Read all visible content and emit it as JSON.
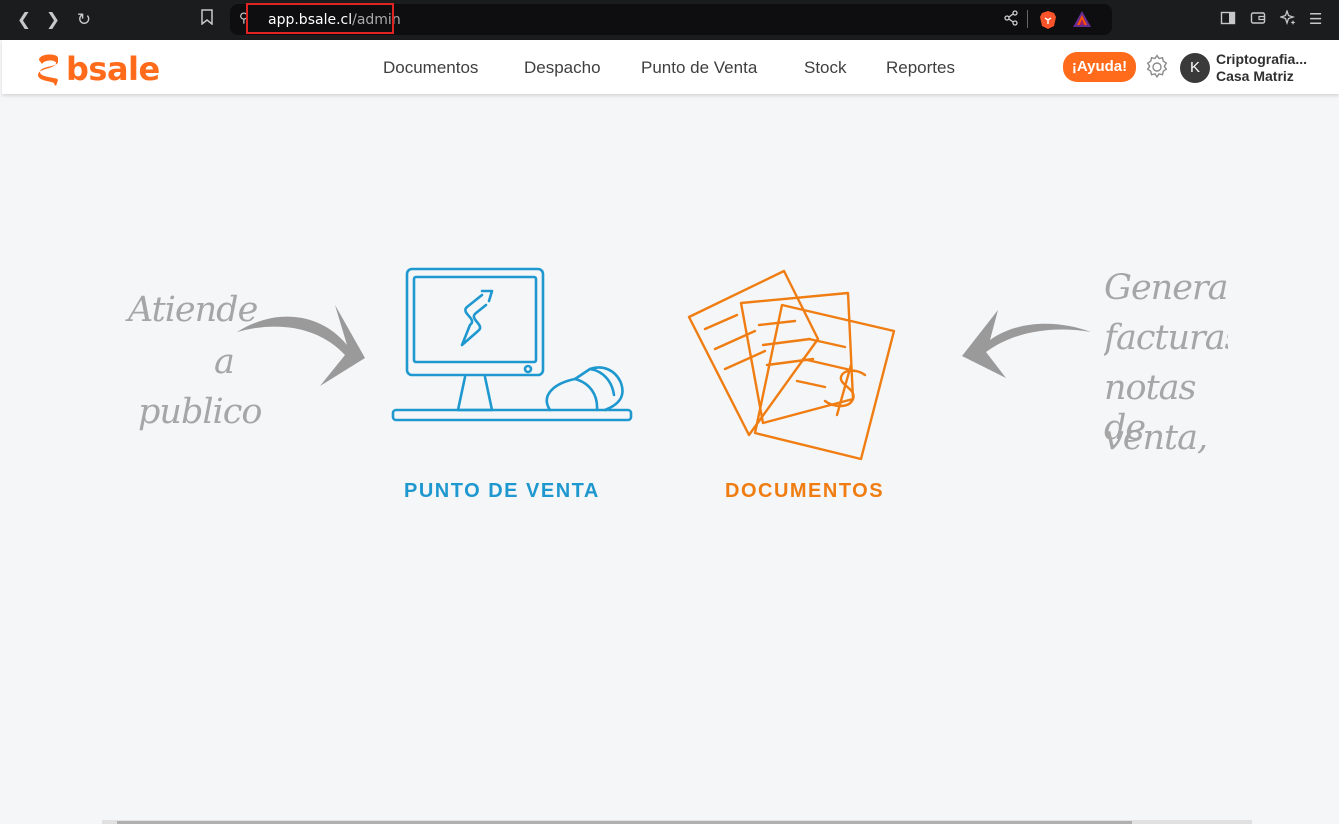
{
  "browser": {
    "url_host": "app.bsale.cl",
    "url_path": "/admin",
    "back_icon": "chevron-left-icon",
    "forward_icon": "chevron-right-icon",
    "reload_icon": "reload-icon"
  },
  "header": {
    "logo_text": "bsale",
    "menu": [
      "Documentos",
      "Despacho",
      "Punto de Venta",
      "Stock",
      "Reportes"
    ],
    "help_label": "¡Ayuda!",
    "avatar_initial": "K",
    "company_name": "Criptografia...",
    "branch_name": "Casa Matriz"
  },
  "main": {
    "left_note": [
      "Atiende",
      "a",
      "publico"
    ],
    "right_note": [
      "Genera",
      "facturas,",
      "notas de",
      "venta, e"
    ],
    "pos_label": "PUNTO DE VENTA",
    "documents_label": "DOCUMENTOS"
  },
  "colors": {
    "brand_orange": "#ff6b1a",
    "pos_blue": "#1e98cf",
    "doc_orange": "#f07d12"
  }
}
